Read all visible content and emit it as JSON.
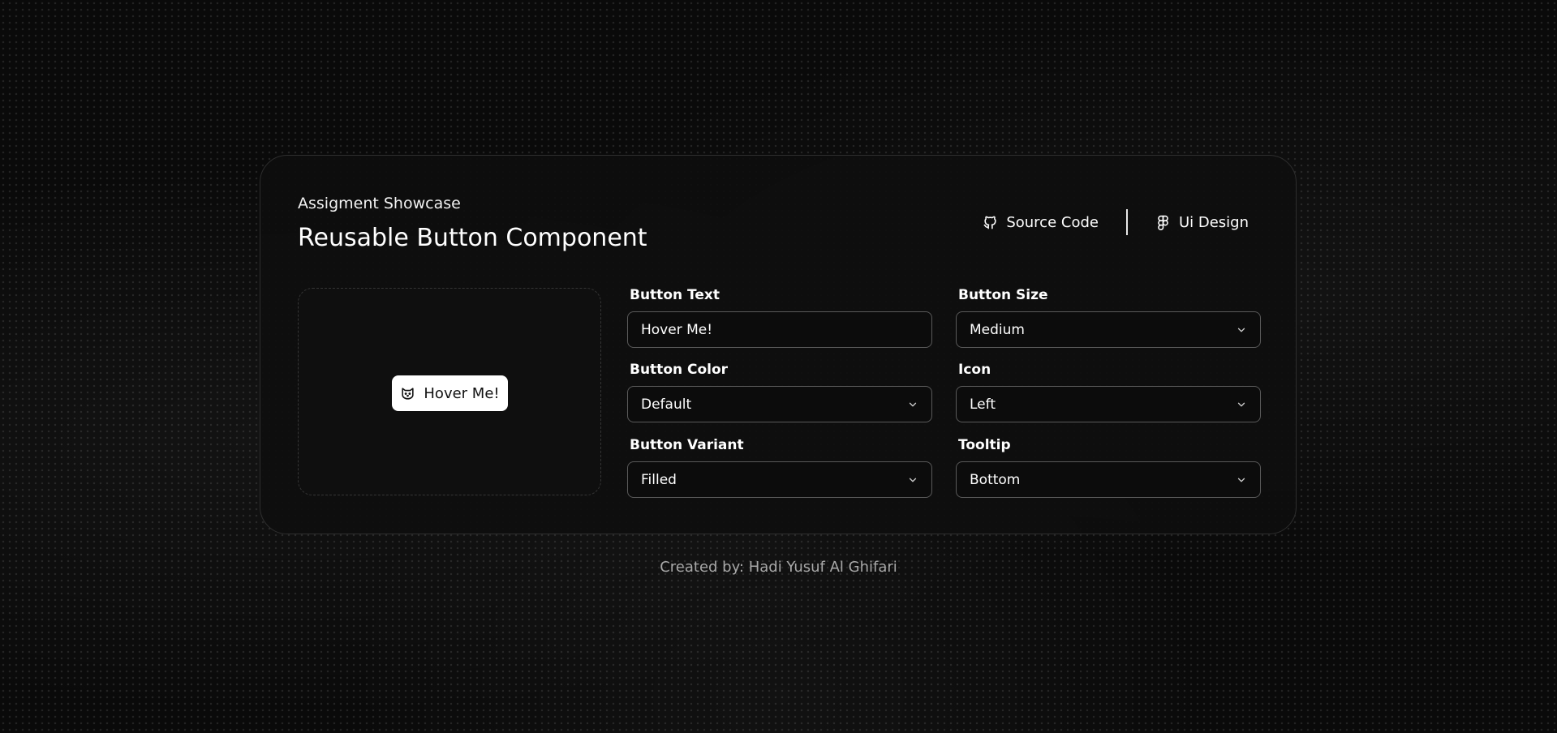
{
  "header": {
    "eyebrow": "Assigment Showcase",
    "title": "Reusable Button Component"
  },
  "links": {
    "source_code": {
      "label": "Source Code",
      "icon": "github-icon"
    },
    "ui_design": {
      "label": "Ui Design",
      "icon": "figma-icon"
    }
  },
  "preview": {
    "button_label": "Hover Me!",
    "button_icon": "cat-icon"
  },
  "form": {
    "button_text": {
      "label": "Button Text",
      "value": "Hover Me!"
    },
    "button_size": {
      "label": "Button Size",
      "value": "Medium"
    },
    "button_color": {
      "label": "Button Color",
      "value": "Default"
    },
    "icon": {
      "label": "Icon",
      "value": "Left"
    },
    "button_variant": {
      "label": "Button Variant",
      "value": "Filled"
    },
    "tooltip": {
      "label": "Tooltip",
      "value": "Bottom"
    }
  },
  "footer": {
    "credit": "Created by: Hadi Yusuf Al Ghifari"
  },
  "colors": {
    "background": "#0a0a0a",
    "card": "#0e0e0e",
    "border": "#2e2e2e",
    "input_border": "#5a5a5a",
    "text": "#ffffff",
    "muted": "#a8a8a8"
  }
}
